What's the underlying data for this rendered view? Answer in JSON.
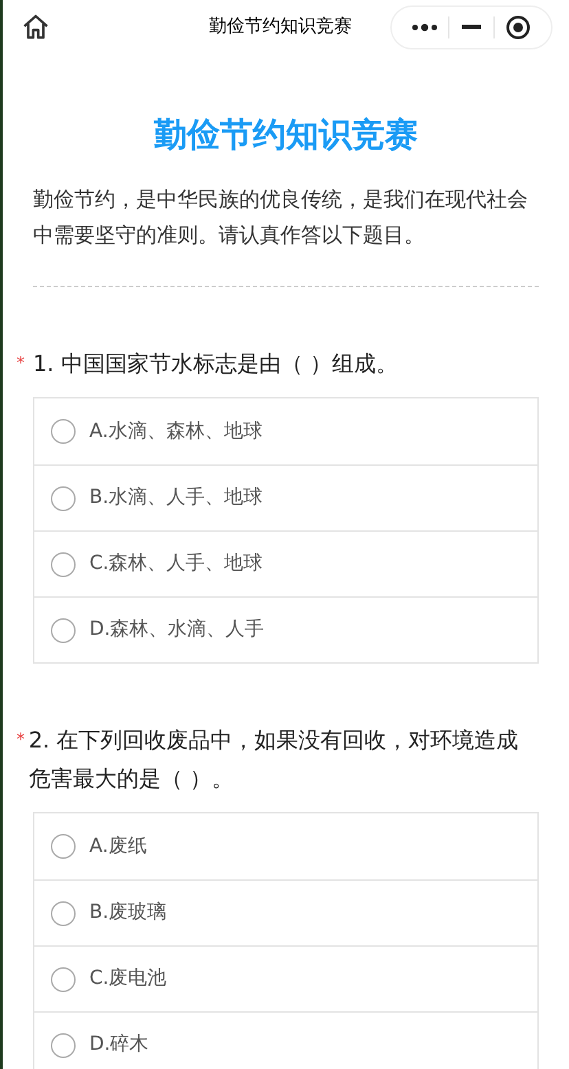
{
  "nav_bar": {
    "title": "勤俭节约知识竞赛"
  },
  "page": {
    "title": "勤俭节约知识竞赛",
    "intro": "勤俭节约，是中华民族的优良传统，是我们在现代社会中需要坚守的准则。请认真作答以下题目。"
  },
  "questions": [
    {
      "required_mark": "*",
      "text": "1. 中国国家节水标志是由（ ）组成。",
      "options": [
        {
          "label": "A.水滴、森林、地球",
          "selected": false
        },
        {
          "label": "B.水滴、人手、地球",
          "selected": false
        },
        {
          "label": "C.森林、人手、地球",
          "selected": false
        },
        {
          "label": "D.森林、水滴、人手",
          "selected": false
        }
      ]
    },
    {
      "required_mark": "*",
      "text": "2. 在下列回收废品中，如果没有回收，对环境造成危害最大的是（ ）。",
      "options": [
        {
          "label": "A.废纸",
          "selected": false
        },
        {
          "label": "B.废玻璃",
          "selected": false
        },
        {
          "label": "C.废电池",
          "selected": false
        },
        {
          "label": "D.碎木",
          "selected": false
        }
      ]
    }
  ]
}
